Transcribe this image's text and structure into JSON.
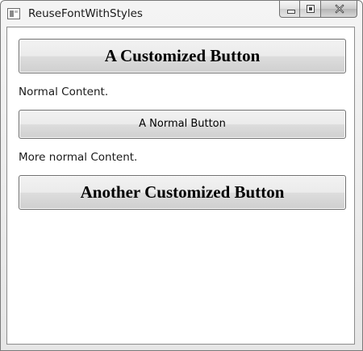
{
  "window": {
    "title": "ReuseFontWithStyles",
    "app_icon": "window-app-icon",
    "caption_buttons": {
      "minimize_icon": "minimize-icon",
      "maximize_icon": "maximize-icon",
      "close_icon": "close-icon"
    }
  },
  "content": {
    "customized_button_1": "A Customized Button",
    "normal_text_1": "Normal Content.",
    "normal_button": "A Normal Button",
    "normal_text_2": "More normal Content.",
    "customized_button_2": "Another Customized Button"
  }
}
